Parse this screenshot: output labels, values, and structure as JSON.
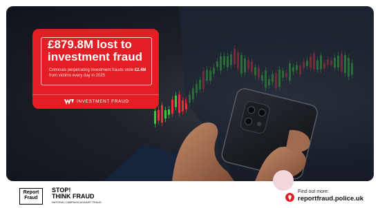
{
  "callout": {
    "headline": "£879.8M lost to investment fraud",
    "sub_prefix": "Criminals perpetrating investment frauds stole ",
    "sub_amount": "£2.4M",
    "sub_suffix": " from victims every day in 2025",
    "tag": "INVESTMENT FRAUD"
  },
  "footer": {
    "report_fraud_logo": "Report Fraud",
    "stop_line1": "STOP!",
    "stop_line2": "THINK FRAUD",
    "stop_line3": "NATIONAL CAMPAIGN AGAINST FRAUD",
    "find_label": "Find out more:",
    "find_url": "reportfraud.police.uk"
  },
  "colors": {
    "brand_red": "#e31e24",
    "candle_green": "#3fc23f",
    "candle_red": "#e0343a"
  },
  "icons": [
    "investment-fraud-logo-icon",
    "report-fraud-logo",
    "stop-think-fraud-logo",
    "location-pin-icon"
  ]
}
